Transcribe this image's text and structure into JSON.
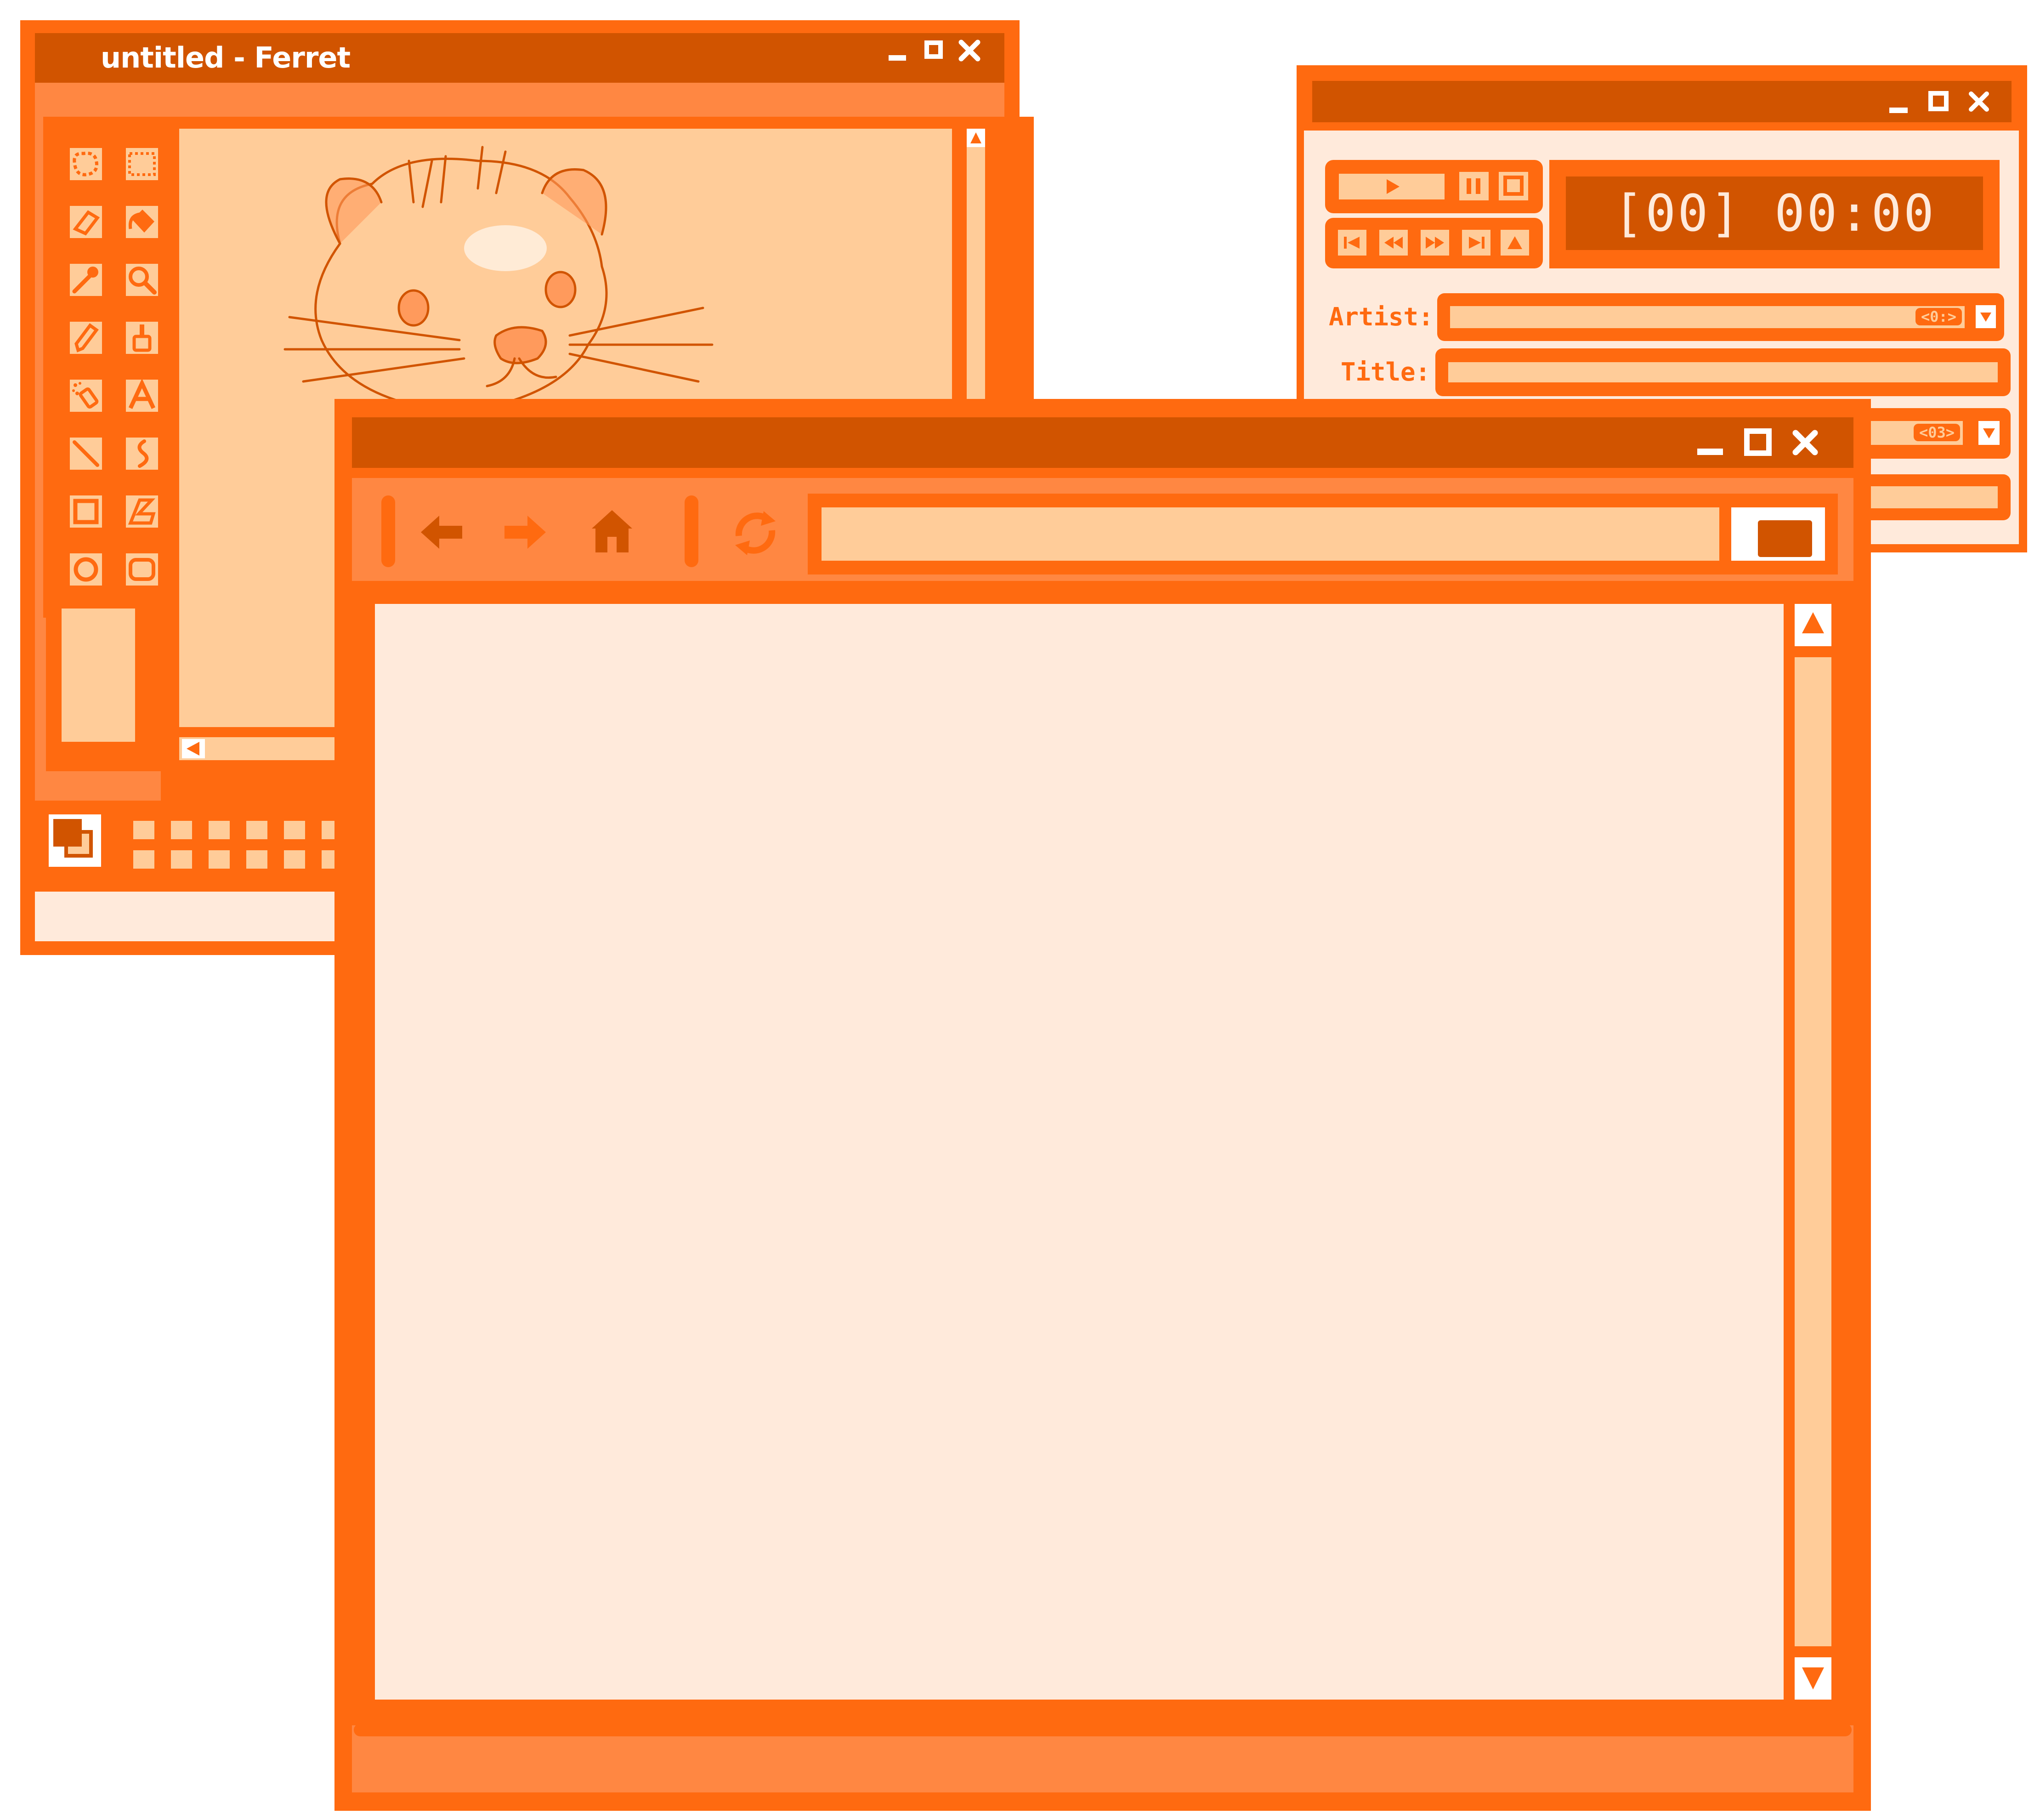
{
  "colors": {
    "frame": "#ff6a10",
    "titlebar": "#d15400",
    "panel": "#ff8742",
    "light": "#ffcc99",
    "content": "#ffeadb",
    "white": "#ffffff"
  },
  "paint": {
    "title": "untitled - Ferret",
    "tools": [
      "free-select-icon",
      "rect-select-icon",
      "eraser-icon",
      "fill-bucket-icon",
      "eyedropper-icon",
      "magnifier-icon",
      "pencil-icon",
      "brush-icon",
      "airbrush-icon",
      "text-icon",
      "line-icon",
      "curve-icon",
      "rectangle-icon",
      "polygon-icon",
      "ellipse-icon",
      "rounded-rect-icon"
    ],
    "canvas_image": "ferret-drawing"
  },
  "player": {
    "time_display": "[00] 00:00",
    "artist_label": "Artist:",
    "title_label": "Title:",
    "artist_badge": "<0:>",
    "second_badge": "<03>",
    "transport_icons": [
      "play-icon",
      "pause-icon",
      "stop-icon"
    ],
    "nav_icons": [
      "first-icon",
      "rewind-icon",
      "fast-forward-icon",
      "last-icon",
      "eject-icon"
    ]
  },
  "browser": {
    "address_value": "",
    "nav_icons": [
      "back-arrow-icon",
      "forward-arrow-icon",
      "home-icon",
      "reload-icon"
    ]
  }
}
